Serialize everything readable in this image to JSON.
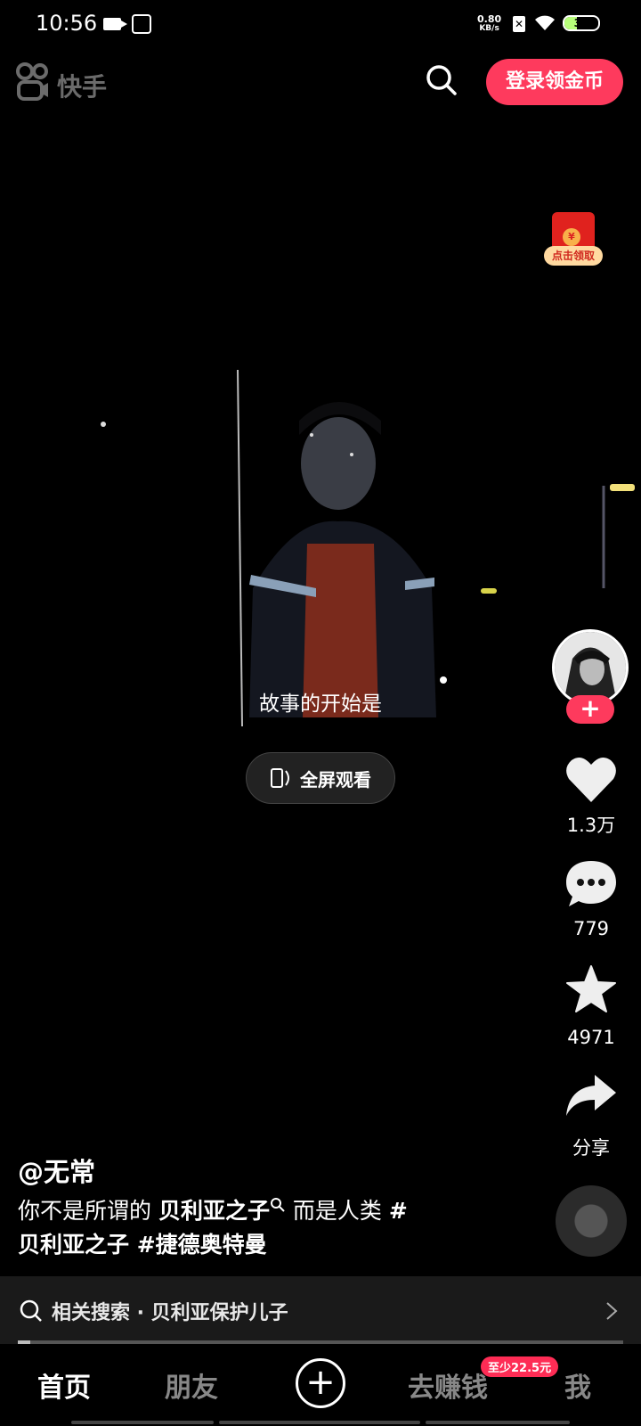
{
  "status_bar": {
    "time": "10:56",
    "net_speed_value": "0.80",
    "net_speed_unit": "KB/s",
    "battery": "37",
    "battery_fraction": 0.37
  },
  "top_bar": {
    "logo_text": "快手",
    "login_button": "登录领金币"
  },
  "redpack": {
    "label": "点击领取",
    "coin": "¥"
  },
  "video": {
    "subtitle": "故事的开始是",
    "fullscreen_button": "全屏观看"
  },
  "right_rail": {
    "follow_symbol": "+",
    "likes": "1.3万",
    "comments": "779",
    "collects": "4971",
    "share": "分享"
  },
  "caption": {
    "author": "@无常",
    "line1_a": "你不是所谓的 ",
    "line1_b": "贝利亚之子",
    "line1_c": " 而是人类 ",
    "line1_d": "#",
    "line2": "贝利亚之子 #捷德奥特曼"
  },
  "related": {
    "text": "相关搜索 · 贝利亚保护儿子"
  },
  "progress": {
    "fraction": 0.02
  },
  "bottom_nav": {
    "home": "首页",
    "friends": "朋友",
    "plus": "+",
    "earn": "去赚钱",
    "earn_badge": "至少22.5元",
    "me": "我"
  },
  "colors": {
    "accent": "#fe3a5d",
    "background": "#000000"
  }
}
